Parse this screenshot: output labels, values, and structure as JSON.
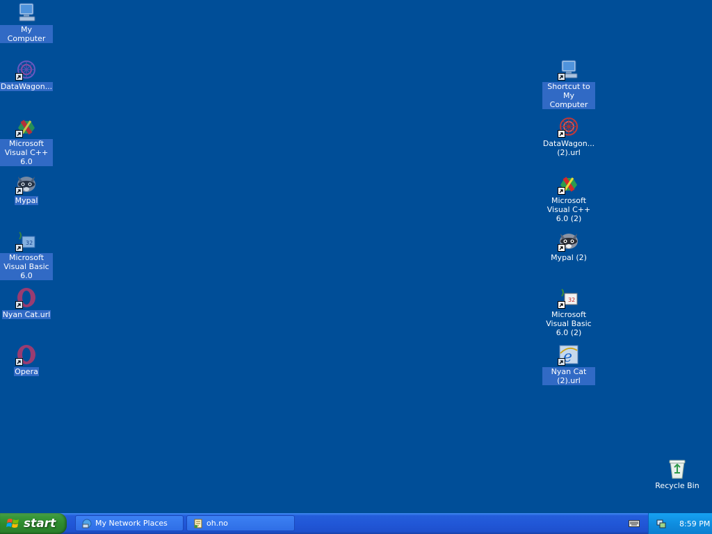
{
  "desktop": {
    "background": "#004E98",
    "icons_left": [
      {
        "label": "My Computer",
        "icon": "computer-icon",
        "shortcut": false
      },
      {
        "label": "DataWagon...",
        "icon": "datawagon-icon",
        "shortcut": true
      },
      {
        "label": "Microsoft Visual C++ 6.0",
        "icon": "visual-cpp-icon",
        "shortcut": true
      },
      {
        "label": "Mypal",
        "icon": "mypal-raccoon-icon",
        "shortcut": true
      },
      {
        "label": "Microsoft Visual Basic 6.0",
        "icon": "visual-basic-icon",
        "shortcut": true
      },
      {
        "label": "Nyan Cat.url",
        "icon": "opera-icon",
        "shortcut": true
      },
      {
        "label": "Opera",
        "icon": "opera-icon",
        "shortcut": true
      }
    ],
    "icons_right": [
      {
        "label": "Shortcut to My Computer",
        "icon": "computer-icon",
        "shortcut": true
      },
      {
        "label": "DataWagon... (2).url",
        "icon": "datawagon-icon",
        "shortcut": true
      },
      {
        "label": "Microsoft Visual C++ 6.0 (2)",
        "icon": "visual-cpp-icon",
        "shortcut": true
      },
      {
        "label": "Mypal (2)",
        "icon": "mypal-raccoon-icon",
        "shortcut": true
      },
      {
        "label": "Microsoft Visual Basic 6.0 (2)",
        "icon": "visual-basic-icon",
        "shortcut": true
      },
      {
        "label": "Nyan Cat (2).url",
        "icon": "internet-explorer-icon",
        "shortcut": true
      }
    ],
    "recycle_bin": {
      "label": "Recycle Bin",
      "icon": "recycle-bin-icon"
    }
  },
  "taskbar": {
    "start_label": "start",
    "tasks": [
      {
        "label": "My Network Places",
        "icon": "network-places-icon"
      },
      {
        "label": "oh.no",
        "icon": "script-icon"
      }
    ],
    "tray": {
      "time": "8:59 PM",
      "icons": [
        "keyboard-icon",
        "network-tray-icon"
      ]
    }
  }
}
